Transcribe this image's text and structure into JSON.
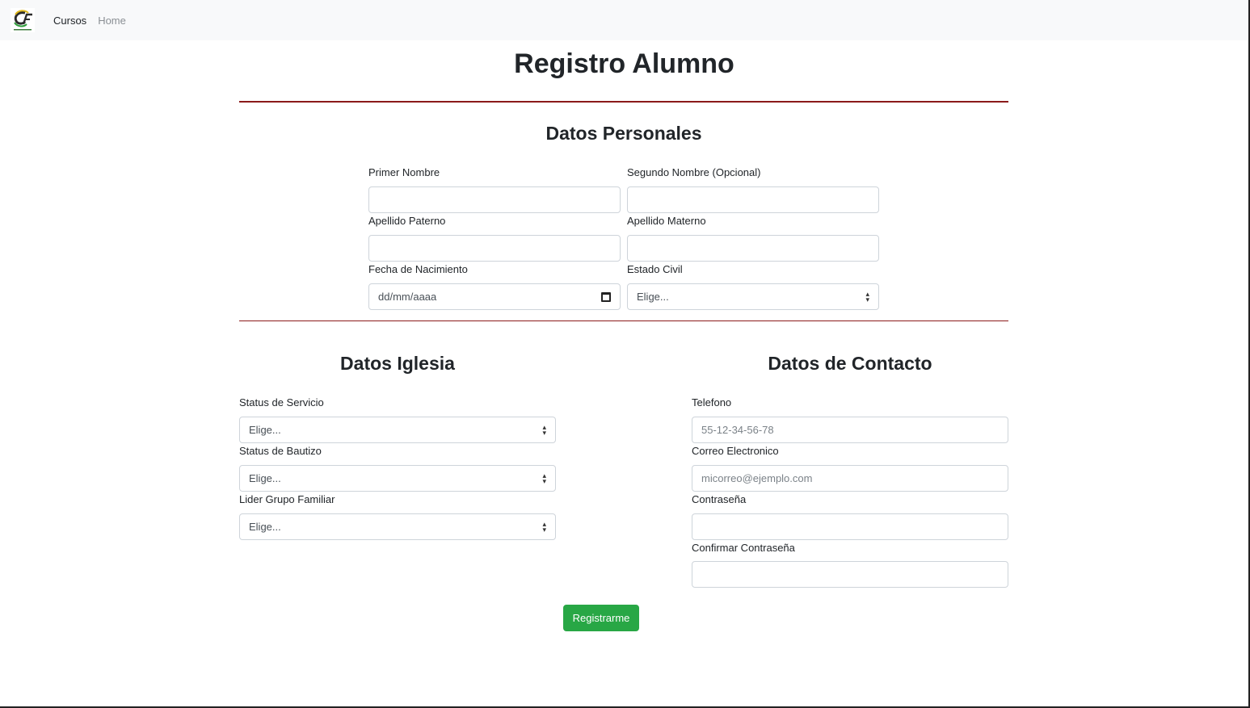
{
  "nav": {
    "links": [
      "Cursos",
      "Home"
    ]
  },
  "page_title": "Registro Alumno",
  "personal": {
    "title": "Datos Personales",
    "primer_nombre": "Primer Nombre",
    "segundo_nombre": "Segundo Nombre (Opcional)",
    "apellido_paterno": "Apellido Paterno",
    "apellido_materno": "Apellido Materno",
    "fecha_nacimiento": "Fecha de Nacimiento",
    "fecha_placeholder": "dd/mm/aaaa",
    "estado_civil": "Estado Civil",
    "estado_civil_value": "Elige..."
  },
  "iglesia": {
    "title": "Datos Iglesia",
    "status_servicio": "Status de Servicio",
    "status_servicio_value": "Elige...",
    "status_bautizo": "Status de Bautizo",
    "status_bautizo_value": "Elige...",
    "lider_grupo": "Lider Grupo Familiar",
    "lider_grupo_value": "Elige..."
  },
  "contacto": {
    "title": "Datos de Contacto",
    "telefono": "Telefono",
    "telefono_placeholder": "55-12-34-56-78",
    "correo": "Correo Electronico",
    "correo_placeholder": "micorreo@ejemplo.com",
    "contrasena": "Contraseña",
    "confirmar": "Confirmar Contraseña"
  },
  "submit_label": "Registrarme",
  "colors": {
    "accent_rule": "#8b1a1a",
    "button": "#28a745",
    "navbar_bg": "#f8f9fa"
  }
}
